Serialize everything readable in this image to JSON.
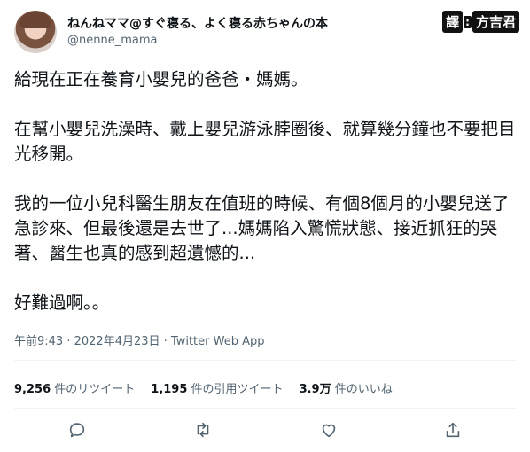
{
  "author": {
    "display_name": "ねんねママ@すぐ寝る、よく寝る赤ちゃんの本",
    "handle": "@nenne_mama"
  },
  "watermark": {
    "seal": "譯",
    "separator": ":",
    "name": "方吉君"
  },
  "tweet": {
    "paragraphs": [
      "給現在正在養育小嬰兒的爸爸・媽媽。",
      "在幫小嬰兒洗澡時、戴上嬰兒游泳脖圈後、就算幾分鐘也不要把目光移開。",
      "我的一位小兒科醫生朋友在值班的時候、有個8個月的小嬰兒送了急診來、但最後還是去世了...媽媽陷入驚慌狀態、接近抓狂的哭著、醫生也真的感到超遺憾的...",
      "好難過啊。。"
    ]
  },
  "meta": {
    "time": "午前9:43",
    "separator1": " · ",
    "date": "2022年4月23日",
    "separator2": " · ",
    "source": "Twitter Web App"
  },
  "stats": {
    "retweets_count": "9,256",
    "retweets_label": "件のリツイート",
    "quotes_count": "1,195",
    "quotes_label": "件の引用ツイート",
    "likes_count": "3.9万",
    "likes_label": "件のいいね"
  },
  "actions": [
    "reply-icon",
    "retweet-icon",
    "like-icon",
    "share-icon"
  ],
  "colors": {
    "text": "#0f1419",
    "secondary": "#536471",
    "divider": "#eff3f4"
  }
}
